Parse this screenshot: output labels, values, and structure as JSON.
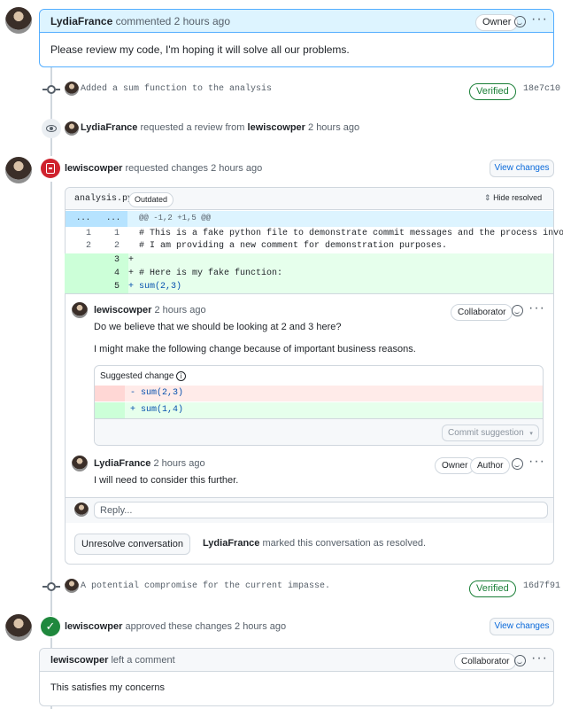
{
  "top_comment": {
    "author": "LydiaFrance",
    "action": "commented 2 hours ago",
    "role": "Owner",
    "body": "Please review my code, I'm hoping it will solve all our problems."
  },
  "commit1": {
    "message": "Added a sum function to the analysis",
    "status": "Verified",
    "sha": "18e7c10"
  },
  "review_request": {
    "author": "LydiaFrance",
    "text_mid": "requested a review from",
    "target": "lewiscowper",
    "time": "2 hours ago"
  },
  "changes_review": {
    "author": "lewiscowper",
    "action": "requested changes 2 hours ago",
    "view_button": "View changes",
    "file": "analysis.py",
    "outdated": "Outdated",
    "hide_resolved": "Hide resolved",
    "hunk_header": "@@ -1,2 +1,5 @@",
    "hunk_left": "...",
    "hunk_right": "...",
    "lines": [
      {
        "old": "1",
        "new": "1",
        "text": "  # This is a fake python file to demonstrate commit messages and the process involved."
      },
      {
        "old": "2",
        "new": "2",
        "text": "  # I am providing a new comment for demonstration purposes."
      },
      {
        "old": "",
        "new": "3",
        "text": "+"
      },
      {
        "old": "",
        "new": "4",
        "text": "+ # Here is my fake function:"
      },
      {
        "old": "",
        "new": "5",
        "text": "+ sum(2,3)"
      }
    ]
  },
  "thread": {
    "c1_author": "lewiscowper",
    "c1_time": "2 hours ago",
    "c1_role": "Collaborator",
    "c1_p1": "Do we believe that we should be looking at 2 and 3 here?",
    "c1_p2": "I might make the following change because of important business reasons.",
    "suggest_label": "Suggested change",
    "suggest_del": "- sum(2,3)",
    "suggest_add": "+ sum(1,4)",
    "commit_suggestion": "Commit suggestion",
    "c2_author": "LydiaFrance",
    "c2_time": "2 hours ago",
    "c2_role1": "Owner",
    "c2_role2": "Author",
    "c2_body": "I will need to consider this further.",
    "reply_placeholder": "Reply...",
    "unresolve": "Unresolve conversation",
    "resolved_by": "LydiaFrance",
    "resolved_text": "marked this conversation as resolved."
  },
  "commit2": {
    "message": "A potential compromise for the current impasse.",
    "status": "Verified",
    "sha": "16d7f91"
  },
  "approve": {
    "author": "lewiscowper",
    "action": "approved these changes 2 hours ago",
    "view_button": "View changes"
  },
  "final_comment": {
    "author": "lewiscowper",
    "action": "left a comment",
    "role": "Collaborator",
    "body": "This satisfies my concerns"
  },
  "colors": {
    "accent": "#0969da",
    "danger": "#cf222e",
    "success": "#1a7f37",
    "add_bg": "#ccffd8",
    "del_bg": "#ffd7d5"
  }
}
